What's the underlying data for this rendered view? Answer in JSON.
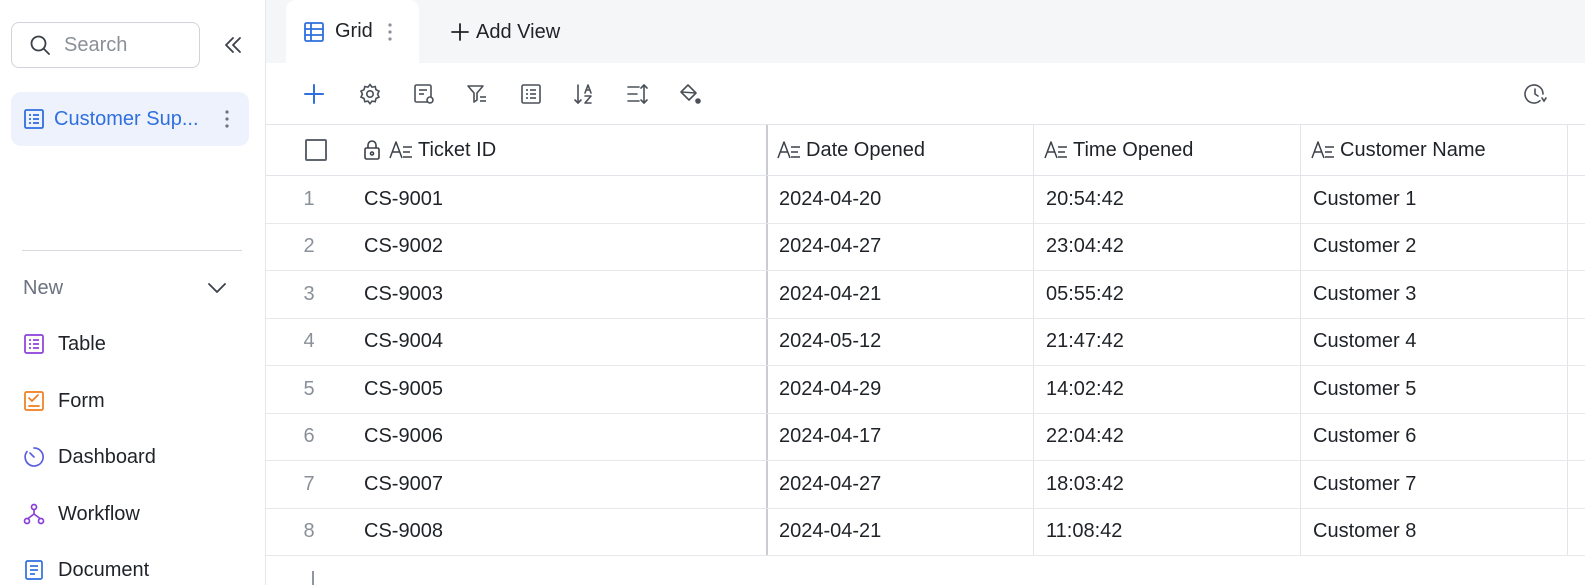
{
  "sidebar": {
    "search_placeholder": "Search",
    "base": {
      "label": "Customer Sup...",
      "icon": "table-icon"
    },
    "new_section": {
      "label": "New",
      "items": [
        {
          "label": "Table",
          "icon": "table-icon",
          "color": "#8b3fd9"
        },
        {
          "label": "Form",
          "icon": "form-icon",
          "color": "#f07c1a"
        },
        {
          "label": "Dashboard",
          "icon": "dashboard-icon",
          "color": "#5b5fe0"
        },
        {
          "label": "Workflow",
          "icon": "workflow-icon",
          "color": "#8b3fd9"
        },
        {
          "label": "Document",
          "icon": "document-icon",
          "color": "#2f6fde"
        }
      ]
    }
  },
  "tabs": {
    "active": {
      "label": "Grid",
      "icon": "grid-icon"
    },
    "add_view_label": "Add View"
  },
  "toolbar": {
    "icons": [
      "add-record-icon",
      "settings-icon",
      "field-settings-icon",
      "filter-icon",
      "group-icon",
      "sort-icon",
      "row-height-icon",
      "color-fill-icon",
      "history-icon"
    ]
  },
  "grid": {
    "columns": [
      "Ticket ID",
      "Date Opened",
      "Time Opened",
      "Customer Name"
    ],
    "rows": [
      {
        "num": "1",
        "ticket_id": "CS-9001",
        "date_opened": "2024-04-20",
        "time_opened": "20:54:42",
        "customer_name": "Customer 1"
      },
      {
        "num": "2",
        "ticket_id": "CS-9002",
        "date_opened": "2024-04-27",
        "time_opened": "23:04:42",
        "customer_name": "Customer 2"
      },
      {
        "num": "3",
        "ticket_id": "CS-9003",
        "date_opened": "2024-04-21",
        "time_opened": "05:55:42",
        "customer_name": "Customer 3"
      },
      {
        "num": "4",
        "ticket_id": "CS-9004",
        "date_opened": "2024-05-12",
        "time_opened": "21:47:42",
        "customer_name": "Customer 4"
      },
      {
        "num": "5",
        "ticket_id": "CS-9005",
        "date_opened": "2024-04-29",
        "time_opened": "14:02:42",
        "customer_name": "Customer 5"
      },
      {
        "num": "6",
        "ticket_id": "CS-9006",
        "date_opened": "2024-04-17",
        "time_opened": "22:04:42",
        "customer_name": "Customer 6"
      },
      {
        "num": "7",
        "ticket_id": "CS-9007",
        "date_opened": "2024-04-27",
        "time_opened": "18:03:42",
        "customer_name": "Customer 7"
      },
      {
        "num": "8",
        "ticket_id": "CS-9008",
        "date_opened": "2024-04-21",
        "time_opened": "11:08:42",
        "customer_name": "Customer 8"
      }
    ]
  },
  "colors": {
    "accent": "#2f6fde",
    "selected_bg": "#eef2fd"
  }
}
